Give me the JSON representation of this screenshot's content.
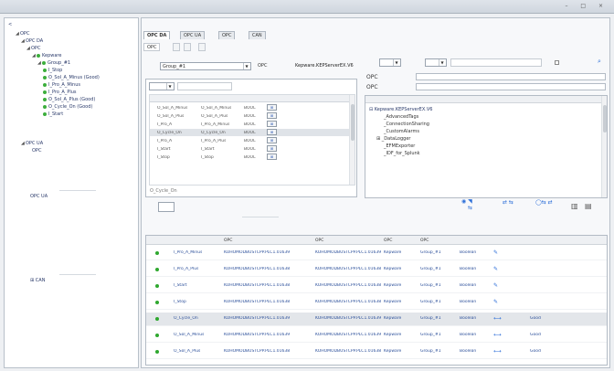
{
  "window": {
    "title": "",
    "controls": "– □ ×"
  },
  "tree": {
    "root": "OPC",
    "n1": "OPC DA",
    "n2": "OPC",
    "n3": "Kepware",
    "n4": "Group_#1",
    "tags": [
      "I_Stop",
      "O_Sol_A_Minus (Good)",
      "I_Pro_A_Minus",
      "I_Pro_A_Plus",
      "O_Sol_A_Plus (Good)",
      "O_Cycle_On (Good)",
      "I_Start"
    ],
    "n5": "",
    "n6": "OPC UA",
    "n7": "OPC",
    "n8": "",
    "ua_label": "OPC UA",
    "can_label": "CAN"
  },
  "tabs": [
    "OPC DA",
    "OPC UA",
    "OPC",
    "CAN"
  ],
  "subtabs": [
    "OPC",
    "",
    "",
    ""
  ],
  "group_label": "",
  "group_value": "Group_#1",
  "server_label": "OPC",
  "server_value": "Kepware.KEPServerEX.V6",
  "left_grid": {
    "filter_combo": "",
    "search_ph": "",
    "headers": [
      "",
      "",
      "",
      "",
      ""
    ],
    "rows": [
      [
        "O_Sol_A_Minus",
        "O_Sol_A_Minus",
        "BOOL",
        ""
      ],
      [
        "O_Sol_A_Plus",
        "O_Sol_A_Plus",
        "BOOL",
        ""
      ],
      [
        "I_Pro_A",
        "I_Pro_A_Minus",
        "BOOL",
        ""
      ],
      [
        "O_Cycle_On",
        "O_Cycle_On",
        "BOOL",
        ""
      ],
      [
        "I_Pro_A",
        "I_Pro_A_Plus",
        "BOOL",
        ""
      ],
      [
        "I_Start",
        "I_Start",
        "BOOL",
        ""
      ],
      [
        "I_Stop",
        "I_Stop",
        "BOOL",
        ""
      ]
    ],
    "footer": "O_Cycle_On"
  },
  "right_panel": {
    "mode_label": "",
    "mode_value": "",
    "filter_label": "",
    "filter_value": "",
    "search_ph": "",
    "checkbox_label": "",
    "item_id_label": "OPC",
    "item_name_label": "OPC",
    "headers": [
      "",
      "",
      ""
    ],
    "tree": [
      "Kepware.KEPServerEX.V6",
      "_AdvancedTags",
      "_ConnectionSharing",
      "_CustomAlarms",
      "_DataLogger",
      "_EFMExporter",
      "_IDF_for_Splunk"
    ]
  },
  "actions_label": "",
  "actions_combo": "",
  "table": {
    "headers": [
      "",
      "",
      "OPC",
      "OPC",
      "OPC",
      "OPC",
      "",
      "",
      "",
      ""
    ],
    "rows": [
      {
        "name": "I_Pro_A_Minus",
        "id": "KOHOMODBUSTCPP.PLC1.01639",
        "item": "KOHOMODBUSTCPP.PLC1.01639",
        "server": "Kepware",
        "group": "Group_#1",
        "type": "Boolean",
        "rw": "pen",
        "quality": ""
      },
      {
        "name": "I_Pro_A_Plus",
        "id": "KOHOMODBUSTCPP.PLC1.01638",
        "item": "KOHOMODBUSTCPP.PLC1.01638",
        "server": "Kepware",
        "group": "Group_#1",
        "type": "Boolean",
        "rw": "pen",
        "quality": ""
      },
      {
        "name": "I_Start",
        "id": "KOHOMODBUSTCPP.PLC1.01638",
        "item": "KOHOMODBUSTCPP.PLC1.01638",
        "server": "Kepware",
        "group": "Group_#1",
        "type": "Boolean",
        "rw": "pen",
        "quality": ""
      },
      {
        "name": "I_Stop",
        "id": "KOHOMODBUSTCPP.PLC1.01638",
        "item": "KOHOMODBUSTCPP.PLC1.01638",
        "server": "Kepware",
        "group": "Group_#1",
        "type": "Boolean",
        "rw": "pen",
        "quality": ""
      },
      {
        "name": "O_Cycle_On",
        "id": "KOHOMODBUSTCPP.PLC1.01639",
        "item": "KOHOMODBUSTCPP.PLC1.01639",
        "server": "Kepware",
        "group": "Group_#1",
        "type": "Boolean",
        "rw": "dash",
        "quality": "Good"
      },
      {
        "name": "O_Sol_A_Minus",
        "id": "KOHOMODBUSTCPP.PLC1.01639",
        "item": "KOHOMODBUSTCPP.PLC1.01639",
        "server": "Kepware",
        "group": "Group_#1",
        "type": "Boolean",
        "rw": "dash",
        "quality": "Good"
      },
      {
        "name": "O_Sol_A_Plus",
        "id": "KOHOMODBUSTCPP.PLC1.01638",
        "item": "KOHOMODBUSTCPP.PLC1.01638",
        "server": "Kepware",
        "group": "Group_#1",
        "type": "Boolean",
        "rw": "dash",
        "quality": "Good"
      }
    ]
  }
}
